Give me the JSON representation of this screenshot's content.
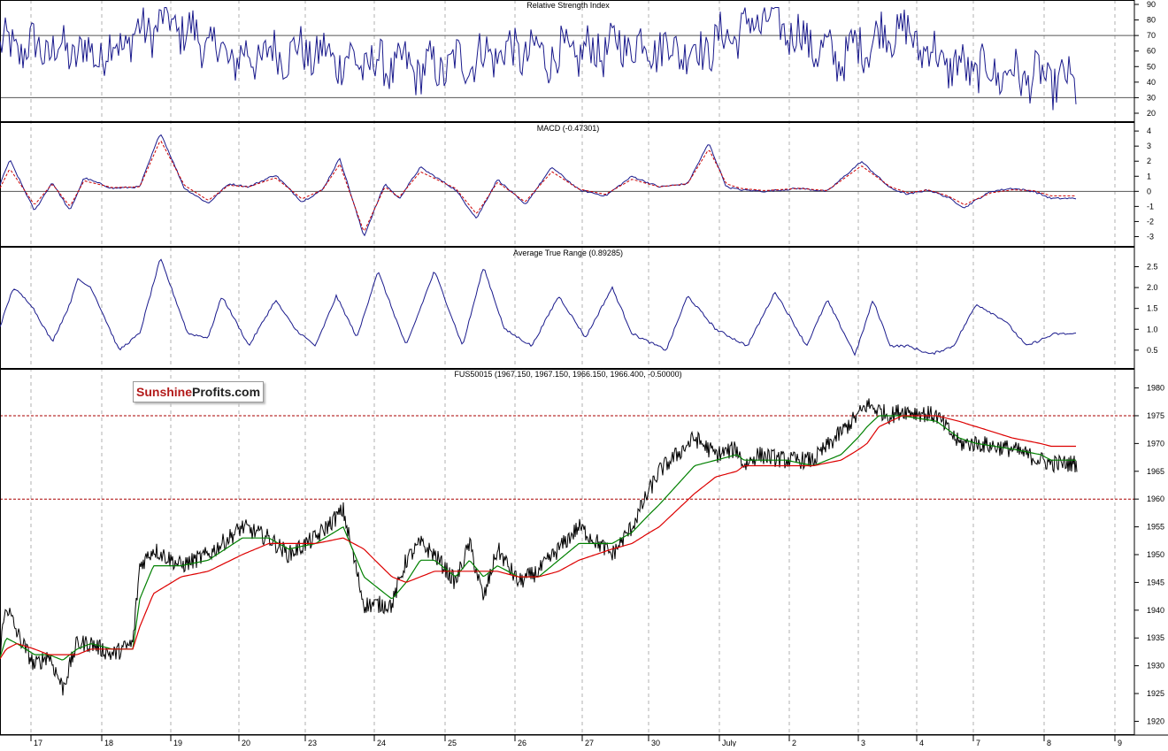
{
  "panels": {
    "rsi": {
      "title": "Relative Strength Index",
      "ylim": [
        20,
        90
      ],
      "ticks": [
        20,
        30,
        40,
        50,
        60,
        70,
        80,
        90
      ],
      "levels": [
        30,
        70
      ],
      "color": "#1a1a8c"
    },
    "macd": {
      "title": "MACD (-0.47301)",
      "ylim": [
        -3.5,
        4.3
      ],
      "ticks": [
        -3,
        -2,
        -1,
        0,
        1,
        2,
        3,
        4
      ],
      "zero_line": 0,
      "macd_color": "#1a1a8c",
      "signal_color": "#cc0000"
    },
    "atr": {
      "title": "Average True Range (0.89285)",
      "ylim": [
        0.2,
        2.85
      ],
      "ticks": [
        0.5,
        1.0,
        1.5,
        2.0,
        2.5
      ],
      "color": "#1a1a8c"
    },
    "price": {
      "title": "FUS50015 (1967.150, 1967.150, 1966.150, 1966.400, -0.50000)",
      "ylim": [
        1918,
        1982
      ],
      "ticks": [
        1920,
        1925,
        1930,
        1935,
        1940,
        1945,
        1950,
        1955,
        1960,
        1965,
        1970,
        1975,
        1980
      ],
      "levels": [
        1960,
        1975
      ],
      "price_color": "#000000",
      "ma_short_color": "#008000",
      "ma_long_color": "#dd0000",
      "level_color": "#aa0000"
    }
  },
  "x_axis": {
    "labels": [
      "17",
      "18",
      "19",
      "20",
      "23",
      "24",
      "25",
      "26",
      "27",
      "30",
      "July",
      "2",
      "3",
      "4",
      "7",
      "8",
      "9"
    ]
  },
  "logo": {
    "part1": "Sunshine",
    "part2": "Profits.com"
  },
  "chart_data": [
    {
      "type": "line",
      "title": "Relative Strength Index",
      "xlabel": "",
      "ylabel": "",
      "ylim": [
        20,
        90
      ],
      "categories": [
        "17",
        "18",
        "19",
        "20",
        "23",
        "24",
        "25",
        "26",
        "27",
        "30",
        "July",
        "2",
        "3",
        "4",
        "7",
        "8"
      ],
      "series": [
        {
          "values": [
            62,
            58,
            80,
            55,
            60,
            52,
            48,
            60,
            57,
            65,
            60,
            82,
            55,
            75,
            50,
            45,
            38
          ]
        }
      ],
      "reference_lines": [
        30,
        70
      ]
    },
    {
      "type": "line",
      "title": "MACD (-0.47301)",
      "xlabel": "",
      "ylabel": "",
      "ylim": [
        -3.5,
        4.3
      ],
      "x": [
        0.0,
        0.15,
        0.5,
        0.75,
        1.0,
        1.2,
        1.6,
        2.0,
        2.3,
        2.65,
        3.0,
        3.3,
        3.6,
        4.0,
        4.4,
        4.7,
        4.95,
        5.3,
        5.6,
        5.8,
        6.1,
        6.6,
        6.9,
        7.2,
        7.6,
        8.0,
        8.4,
        8.8,
        9.2,
        9.6,
        10.0,
        10.3,
        10.55,
        10.75,
        11.1,
        11.6,
        12.0,
        12.5,
        13.0,
        13.3,
        13.65,
        14.0,
        14.3,
        14.7,
        15.0,
        15.3,
        15.55
      ],
      "series": [
        {
          "values": [
            0.3,
            2.1,
            -1.3,
            0.6,
            -1.3,
            0.9,
            0.2,
            0.3,
            3.9,
            0.2,
            -0.8,
            0.5,
            0.3,
            1.1,
            -0.7,
            0.1,
            2.2,
            -3.0,
            0.5,
            -0.5,
            1.6,
            0.1,
            -1.8,
            0.8,
            -0.9,
            1.6,
            0.1,
            -0.3,
            1.0,
            0.3,
            0.5,
            3.2,
            0.3,
            0.1,
            0.0,
            0.2,
            0.0,
            2.0,
            0.2,
            -0.2,
            0.1,
            -0.4,
            -1.1,
            0.0,
            0.2,
            0.0,
            -0.47
          ]
        },
        {
          "values": [
            0.1,
            1.5,
            -0.9,
            0.5,
            -1.0,
            0.7,
            0.25,
            0.3,
            3.4,
            0.4,
            -0.6,
            0.4,
            0.3,
            0.9,
            -0.5,
            0.1,
            1.8,
            -2.7,
            0.3,
            -0.4,
            1.3,
            0.2,
            -1.5,
            0.6,
            -0.7,
            1.3,
            0.15,
            -0.2,
            0.8,
            0.3,
            0.5,
            2.8,
            0.5,
            0.2,
            0.05,
            0.2,
            0.05,
            1.7,
            0.3,
            -0.1,
            0.1,
            -0.3,
            -0.9,
            -0.1,
            0.1,
            0.05,
            -0.3
          ]
        }
      ]
    },
    {
      "type": "line",
      "title": "Average True Range (0.89285)",
      "xlabel": "",
      "ylabel": "",
      "ylim": [
        0.2,
        2.85
      ],
      "x": [
        0.0,
        0.2,
        0.45,
        0.75,
        1.0,
        1.1,
        1.3,
        1.7,
        2.0,
        2.3,
        2.7,
        3.0,
        3.2,
        3.6,
        4.0,
        4.3,
        4.6,
        4.9,
        5.2,
        5.5,
        5.9,
        6.3,
        6.7,
        7.0,
        7.3,
        7.7,
        8.1,
        8.5,
        8.9,
        9.2,
        9.7,
        10.0,
        10.4,
        10.85,
        11.25,
        11.7,
        12.0,
        12.4,
        12.7,
        13.0,
        13.3,
        13.7,
        14.1,
        14.5,
        14.9,
        15.2,
        15.6
      ],
      "series": [
        {
          "values": [
            1.0,
            2.0,
            1.6,
            0.7,
            1.6,
            2.2,
            2.0,
            0.5,
            0.9,
            2.7,
            0.9,
            0.8,
            1.8,
            0.6,
            1.7,
            1.0,
            0.6,
            1.8,
            0.8,
            2.4,
            0.6,
            2.4,
            0.6,
            2.5,
            1.0,
            0.6,
            1.8,
            0.8,
            2.0,
            0.9,
            0.5,
            1.8,
            1.0,
            0.6,
            1.9,
            0.6,
            1.7,
            0.4,
            1.7,
            0.6,
            0.6,
            0.4,
            0.6,
            1.6,
            1.2,
            0.6,
            0.89
          ]
        }
      ]
    },
    {
      "type": "line",
      "title": "FUS50015 (1967.150, 1967.150, 1966.150, 1966.400, -0.50000)",
      "xlabel": "",
      "ylabel": "",
      "ylim": [
        1918,
        1982
      ],
      "x": [
        0.0,
        0.1,
        0.25,
        0.5,
        0.7,
        0.9,
        1.1,
        1.3,
        1.6,
        1.9,
        2.0,
        2.2,
        2.6,
        3.0,
        3.5,
        3.9,
        4.2,
        4.6,
        5.0,
        5.3,
        5.7,
        5.9,
        6.1,
        6.3,
        6.6,
        6.8,
        7.0,
        7.2,
        7.5,
        7.8,
        8.1,
        8.4,
        8.9,
        9.2,
        9.6,
        10.1,
        10.4,
        10.7,
        10.8,
        11.0,
        11.4,
        11.8,
        12.2,
        12.6,
        12.8,
        13.0,
        13.2,
        13.8,
        14.2,
        14.5,
        15.0,
        15.4,
        15.55
      ],
      "series": [
        {
          "name": "FUS50015",
          "values": [
            1932,
            1941,
            1936,
            1930,
            1932,
            1926,
            1934,
            1934,
            1932,
            1934,
            1948,
            1951,
            1948,
            1950,
            1955,
            1953,
            1950,
            1953,
            1958,
            1941,
            1941,
            1949,
            1952,
            1950,
            1945,
            1952,
            1942,
            1951,
            1945,
            1947,
            1951,
            1955,
            1950,
            1955,
            1965,
            1971,
            1968,
            1969,
            1966,
            1968,
            1967,
            1967,
            1972,
            1977,
            1976,
            1975,
            1976,
            1975,
            1970,
            1970,
            1969,
            1967,
            1966.4
          ]
        },
        {
          "name": "MA short",
          "values": [
            1931,
            1935,
            1934,
            1932,
            1932,
            1931,
            1933,
            1934,
            1933,
            1933,
            1942,
            1948,
            1948,
            1949,
            1953,
            1953,
            1951,
            1952,
            1955,
            1946,
            1942,
            1945,
            1949,
            1949,
            1946,
            1949,
            1946,
            1948,
            1946,
            1946,
            1949,
            1952,
            1952,
            1954,
            1959,
            1966,
            1967,
            1968,
            1967,
            1967,
            1967,
            1966,
            1968,
            1973,
            1975,
            1975,
            1975,
            1974,
            1971,
            1970,
            1969,
            1968,
            1967
          ]
        },
        {
          "name": "MA long",
          "values": [
            1931,
            1933,
            1934,
            1933,
            1932,
            1932,
            1932,
            1933,
            1933,
            1933,
            1937,
            1943,
            1946,
            1947,
            1950,
            1952,
            1952,
            1952,
            1953,
            1951,
            1946,
            1945,
            1946,
            1947,
            1947,
            1947,
            1947,
            1947,
            1946,
            1946,
            1947,
            1949,
            1951,
            1952,
            1955,
            1961,
            1964,
            1965,
            1966,
            1966,
            1966,
            1966,
            1967,
            1970,
            1973,
            1974,
            1975,
            1975,
            1974,
            1973,
            1971,
            1970,
            1969.5
          ]
        }
      ],
      "reference_lines": [
        1960,
        1975
      ]
    }
  ]
}
